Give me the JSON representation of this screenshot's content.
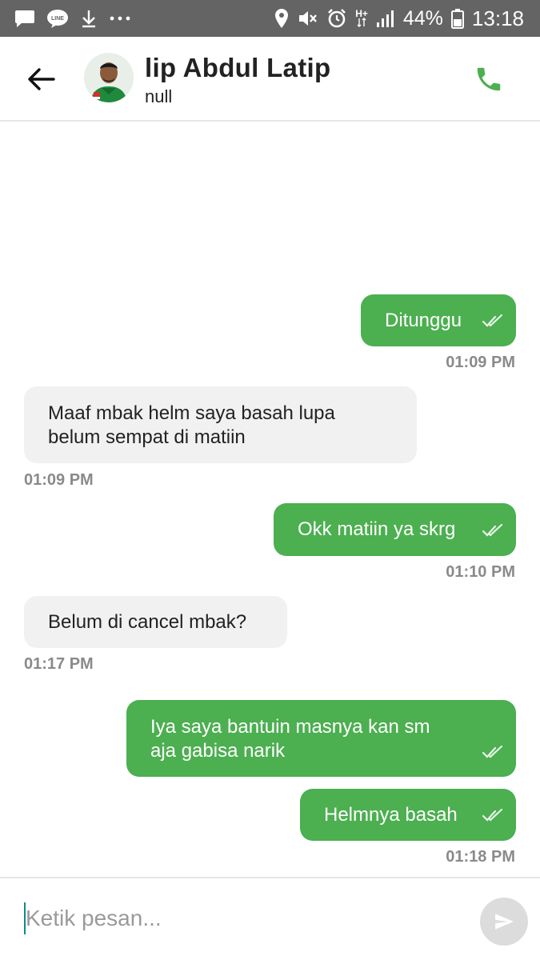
{
  "status_bar": {
    "battery": "44%",
    "time": "13:18",
    "left_icons": [
      "chat-notification-icon",
      "line-app-icon",
      "download-icon",
      "more-dots-icon"
    ],
    "right_icons": [
      "location-icon",
      "mute-icon",
      "alarm-icon",
      "network-type-icon",
      "signal-icon",
      "battery-icon"
    ],
    "network_label": "H+"
  },
  "header": {
    "name": "lip Abdul Latip",
    "status": "null",
    "accent": "#4caf50"
  },
  "messages": [
    {
      "direction": "out",
      "lines": [
        "Ditunggu"
      ],
      "time": "01:09 PM",
      "read": true
    },
    {
      "direction": "in",
      "lines": [
        "Maaf mbak helm saya basah lupa",
        "belum sempat di matiin"
      ],
      "time": "01:09 PM"
    },
    {
      "direction": "out",
      "lines": [
        "Okk matiin ya skrg"
      ],
      "time": "01:10 PM",
      "read": true
    },
    {
      "direction": "in",
      "lines": [
        "Belum di cancel mbak?"
      ],
      "time": "01:17 PM"
    },
    {
      "direction": "out",
      "lines": [
        "Iya saya bantuin masnya kan sm",
        "aja gabisa narik"
      ],
      "time": "",
      "read": true
    },
    {
      "direction": "out",
      "lines": [
        "Helmnya basah"
      ],
      "time": "01:18 PM",
      "read": true
    }
  ],
  "input": {
    "placeholder": "Ketik pesan..."
  },
  "colors": {
    "outgoing_bubble": "#4caf50",
    "incoming_bubble": "#f1f1f1",
    "status_bar": "#646464"
  }
}
